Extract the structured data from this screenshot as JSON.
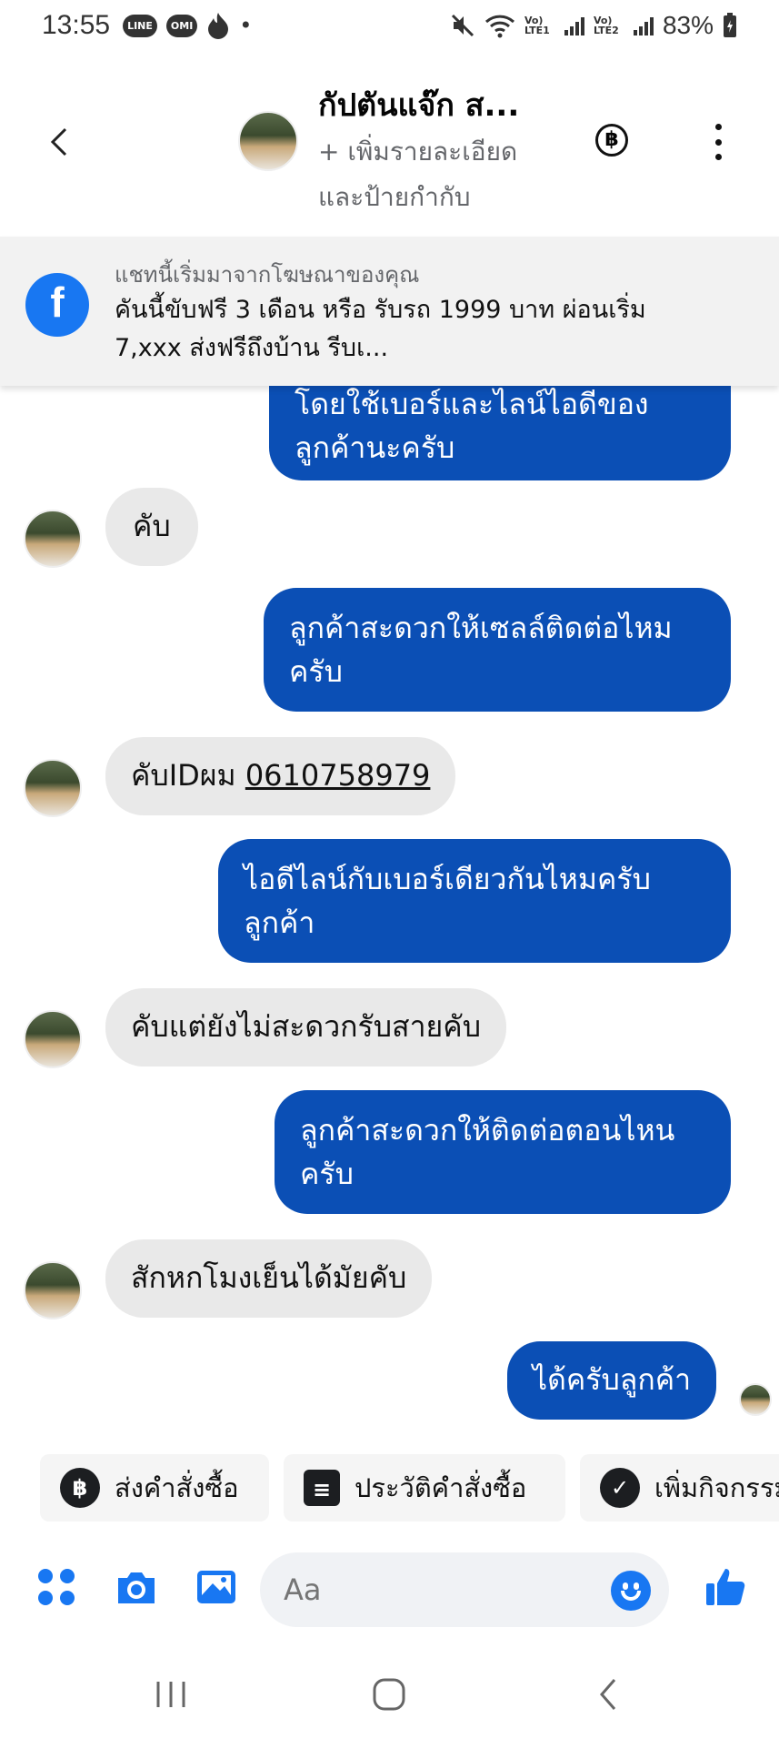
{
  "status_bar": {
    "time": "13:55",
    "line_label": "LINE",
    "omi_label": "OMI",
    "dot": "•",
    "sim1_label": "Vo) LTE1",
    "sim2_label": "Vo) LTE2",
    "battery": "83%"
  },
  "header": {
    "name": "กัปตันแจ๊ก ส...",
    "subtitle": "+ เพิ่มรายละเอียดและป้ายกำกับ",
    "baht_icon": "฿"
  },
  "ad_banner": {
    "label": "แชทนี้เริ่มมาจากโฆษณาของคุณ",
    "text": "คันนี้ขับฟรี 3 เดือน หรือ รับรถ 1999 บาท ผ่อนเริ่ม 7,xxx ส่งฟรีถึงบ้าน รีบเ..."
  },
  "messages": [
    {
      "side": "out",
      "text": "โดยใช้เบอร์และไลน์ไอดีของลูกค้านะครับ"
    },
    {
      "side": "in",
      "text": "คับ"
    },
    {
      "side": "out",
      "text": "ลูกค้าสะดวกให้เซลล์ติดต่อไหมครับ"
    },
    {
      "side": "in",
      "prefix": "คับIDผม ",
      "link": "0610758979"
    },
    {
      "side": "out",
      "text": "ไอดีไลน์กับเบอร์เดียวกันไหมครับลูกค้า"
    },
    {
      "side": "in",
      "text": "คับแต่ยังไม่สะดวกรับสายคับ"
    },
    {
      "side": "out",
      "text": "ลูกค้าสะดวกให้ติดต่อตอนไหนครับ"
    },
    {
      "side": "in",
      "text": "สักหกโมงเย็นได้มัยคับ"
    },
    {
      "side": "out",
      "text": "ได้ครับลูกค้า"
    }
  ],
  "chips": [
    {
      "icon": "฿",
      "label": "ส่งคำสั่งซื้อ"
    },
    {
      "icon": "≡",
      "label": "ประวัติคำสั่งซื้อ"
    },
    {
      "icon": "✓",
      "label": "เพิ่มกิจกรรม"
    }
  ],
  "composer": {
    "placeholder": "Aa"
  },
  "colors": {
    "outgoing_bubble": "#0b4fb5",
    "incoming_bubble": "#e9e9e9",
    "messenger_blue": "#1877f2"
  }
}
